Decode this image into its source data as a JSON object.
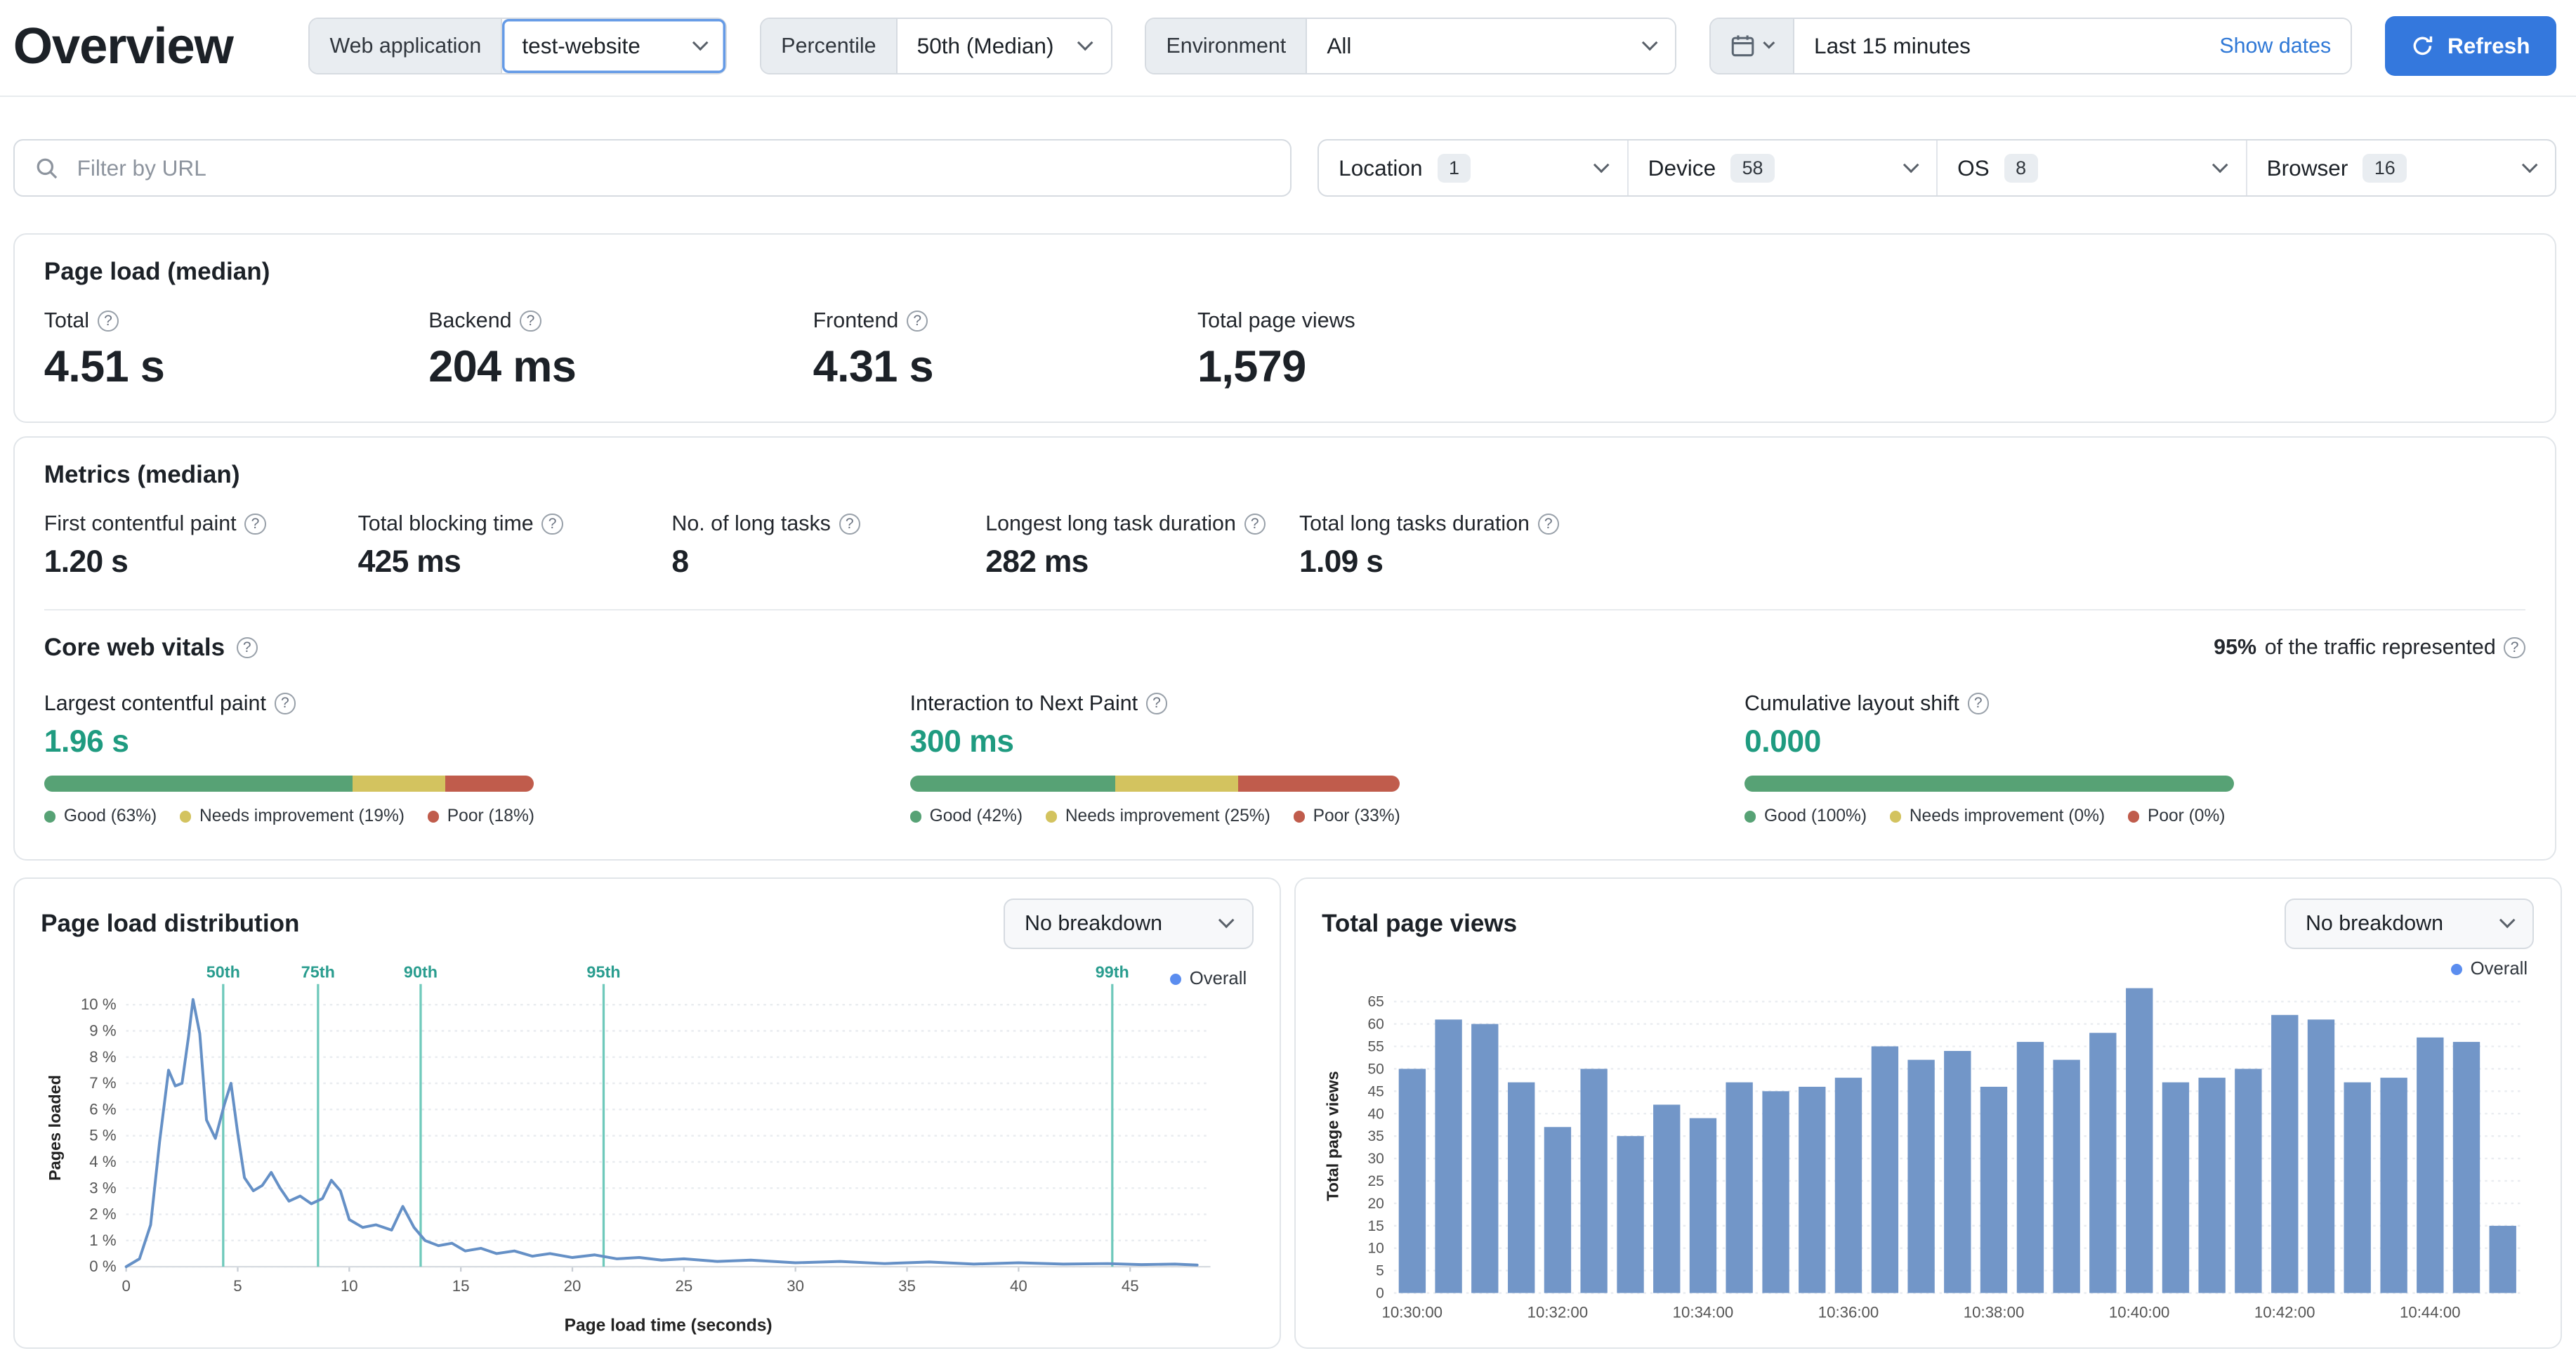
{
  "colors": {
    "accent_blue": "#3478dd",
    "good": "#57a275",
    "needs_improvement": "#d3c35f",
    "poor": "#c05c4c",
    "teal_value": "#1f9b80",
    "chart_line": "#6590c6",
    "chart_bar": "#7296c8",
    "percentile_line": "#6fc9bb",
    "percentile_label": "#2a9d8f",
    "legend_dot": "#5b8def"
  },
  "header": {
    "title": "Overview",
    "web_application": {
      "label": "Web application",
      "value": "test-website"
    },
    "percentile": {
      "label": "Percentile",
      "value": "50th (Median)"
    },
    "environment": {
      "label": "Environment",
      "value": "All"
    },
    "time_range": {
      "value": "Last 15 minutes",
      "show_dates": "Show dates"
    },
    "refresh_label": "Refresh"
  },
  "filters": {
    "search_placeholder": "Filter by URL",
    "facets": [
      {
        "label": "Location",
        "count": "1"
      },
      {
        "label": "Device",
        "count": "58"
      },
      {
        "label": "OS",
        "count": "8"
      },
      {
        "label": "Browser",
        "count": "16"
      }
    ]
  },
  "page_load_card": {
    "title": "Page load (median)",
    "stats": [
      {
        "label": "Total",
        "value": "4.51 s"
      },
      {
        "label": "Backend",
        "value": "204 ms"
      },
      {
        "label": "Frontend",
        "value": "4.31 s"
      },
      {
        "label": "Total page views",
        "value": "1,579"
      }
    ]
  },
  "metrics_card": {
    "title": "Metrics (median)",
    "stats": [
      {
        "label": "First contentful paint",
        "value": "1.20 s"
      },
      {
        "label": "Total blocking time",
        "value": "425 ms"
      },
      {
        "label": "No. of long tasks",
        "value": "8"
      },
      {
        "label": "Longest long task duration",
        "value": "282 ms"
      },
      {
        "label": "Total long tasks duration",
        "value": "1.09 s"
      }
    ],
    "core_web_vitals": {
      "title": "Core web vitals",
      "traffic": {
        "strong": "95%",
        "rest": " of the traffic represented"
      },
      "vitals": [
        {
          "label": "Largest contentful paint",
          "value": "1.96 s",
          "good": 63,
          "needs": 19,
          "poor": 18,
          "legend": [
            "Good (63%)",
            "Needs improvement (19%)",
            "Poor (18%)"
          ]
        },
        {
          "label": "Interaction to Next Paint",
          "value": "300 ms",
          "good": 42,
          "needs": 25,
          "poor": 33,
          "legend": [
            "Good (42%)",
            "Needs improvement (25%)",
            "Poor (33%)"
          ]
        },
        {
          "label": "Cumulative layout shift",
          "value": "0.000",
          "good": 100,
          "needs": 0,
          "poor": 0,
          "legend": [
            "Good (100%)",
            "Needs improvement (0%)",
            "Poor (0%)"
          ]
        }
      ]
    }
  },
  "distribution_card": {
    "title": "Page load distribution",
    "breakdown_value": "No breakdown",
    "legend_label": "Overall"
  },
  "page_views_card": {
    "title": "Total page views",
    "breakdown_value": "No breakdown",
    "legend_label": "Overall"
  },
  "chart_data": [
    {
      "type": "line",
      "title": "Page load distribution",
      "xlabel": "Page load time (seconds)",
      "ylabel": "Pages loaded",
      "xlim": [
        0,
        48.6
      ],
      "ylim": [
        0,
        10.6
      ],
      "x_ticks": [
        0,
        5,
        10,
        15,
        20,
        25,
        30,
        35,
        40,
        45
      ],
      "y_ticks": [
        0,
        1,
        2,
        3,
        4,
        5,
        6,
        7,
        8,
        9,
        10
      ],
      "y_tick_suffix": " %",
      "grid": true,
      "legend_position": "top-right",
      "percentile_markers": [
        {
          "label": "50th",
          "x": 4.35
        },
        {
          "label": "75th",
          "x": 8.6
        },
        {
          "label": "90th",
          "x": 13.2
        },
        {
          "label": "95th",
          "x": 21.4
        },
        {
          "label": "99th",
          "x": 44.2
        }
      ],
      "series": [
        {
          "name": "Overall",
          "points": [
            [
              0,
              0
            ],
            [
              0.6,
              0.3
            ],
            [
              1.1,
              1.6
            ],
            [
              1.5,
              4.8
            ],
            [
              1.9,
              7.5
            ],
            [
              2.2,
              6.9
            ],
            [
              2.5,
              7.0
            ],
            [
              2.8,
              8.8
            ],
            [
              3.0,
              10.2
            ],
            [
              3.3,
              8.9
            ],
            [
              3.6,
              5.6
            ],
            [
              4.0,
              4.9
            ],
            [
              4.4,
              6.2
            ],
            [
              4.7,
              7.0
            ],
            [
              5.0,
              5.1
            ],
            [
              5.3,
              3.4
            ],
            [
              5.7,
              2.9
            ],
            [
              6.1,
              3.1
            ],
            [
              6.5,
              3.6
            ],
            [
              6.9,
              3.0
            ],
            [
              7.3,
              2.5
            ],
            [
              7.8,
              2.7
            ],
            [
              8.3,
              2.4
            ],
            [
              8.8,
              2.6
            ],
            [
              9.2,
              3.3
            ],
            [
              9.6,
              2.9
            ],
            [
              10.0,
              1.8
            ],
            [
              10.6,
              1.5
            ],
            [
              11.2,
              1.6
            ],
            [
              11.9,
              1.4
            ],
            [
              12.4,
              2.3
            ],
            [
              12.9,
              1.5
            ],
            [
              13.4,
              1.0
            ],
            [
              14.0,
              0.8
            ],
            [
              14.6,
              0.9
            ],
            [
              15.2,
              0.6
            ],
            [
              15.9,
              0.7
            ],
            [
              16.6,
              0.5
            ],
            [
              17.4,
              0.6
            ],
            [
              18.2,
              0.4
            ],
            [
              19.0,
              0.5
            ],
            [
              20.0,
              0.35
            ],
            [
              21.0,
              0.45
            ],
            [
              22.0,
              0.3
            ],
            [
              23.0,
              0.35
            ],
            [
              24.0,
              0.25
            ],
            [
              25.0,
              0.3
            ],
            [
              26.5,
              0.2
            ],
            [
              28.0,
              0.25
            ],
            [
              30.0,
              0.15
            ],
            [
              32.0,
              0.2
            ],
            [
              34.0,
              0.12
            ],
            [
              36.0,
              0.18
            ],
            [
              38.0,
              0.1
            ],
            [
              40.0,
              0.15
            ],
            [
              42.0,
              0.1
            ],
            [
              44.0,
              0.12
            ],
            [
              45.5,
              0.08
            ],
            [
              47.0,
              0.1
            ],
            [
              48.0,
              0.06
            ]
          ]
        }
      ]
    },
    {
      "type": "bar",
      "title": "Total page views",
      "ylabel": "Total page views",
      "ylim": [
        0,
        70
      ],
      "y_tick_step": 5,
      "y_tick_max": 65,
      "grid": true,
      "series_name": "Overall",
      "interval_seconds": 30,
      "start_time": "10:30:00",
      "values": [
        50,
        61,
        60,
        47,
        37,
        50,
        35,
        42,
        39,
        47,
        45,
        46,
        48,
        55,
        52,
        54,
        46,
        56,
        52,
        58,
        68,
        47,
        48,
        50,
        62,
        61,
        47,
        48,
        57,
        56,
        15
      ],
      "x_labels": [
        {
          "index": 0,
          "label": "10:30:00"
        },
        {
          "index": 4,
          "label": "10:32:00"
        },
        {
          "index": 8,
          "label": "10:34:00"
        },
        {
          "index": 12,
          "label": "10:36:00"
        },
        {
          "index": 16,
          "label": "10:38:00"
        },
        {
          "index": 20,
          "label": "10:40:00"
        },
        {
          "index": 24,
          "label": "10:42:00"
        },
        {
          "index": 28,
          "label": "10:44:00"
        }
      ]
    }
  ]
}
